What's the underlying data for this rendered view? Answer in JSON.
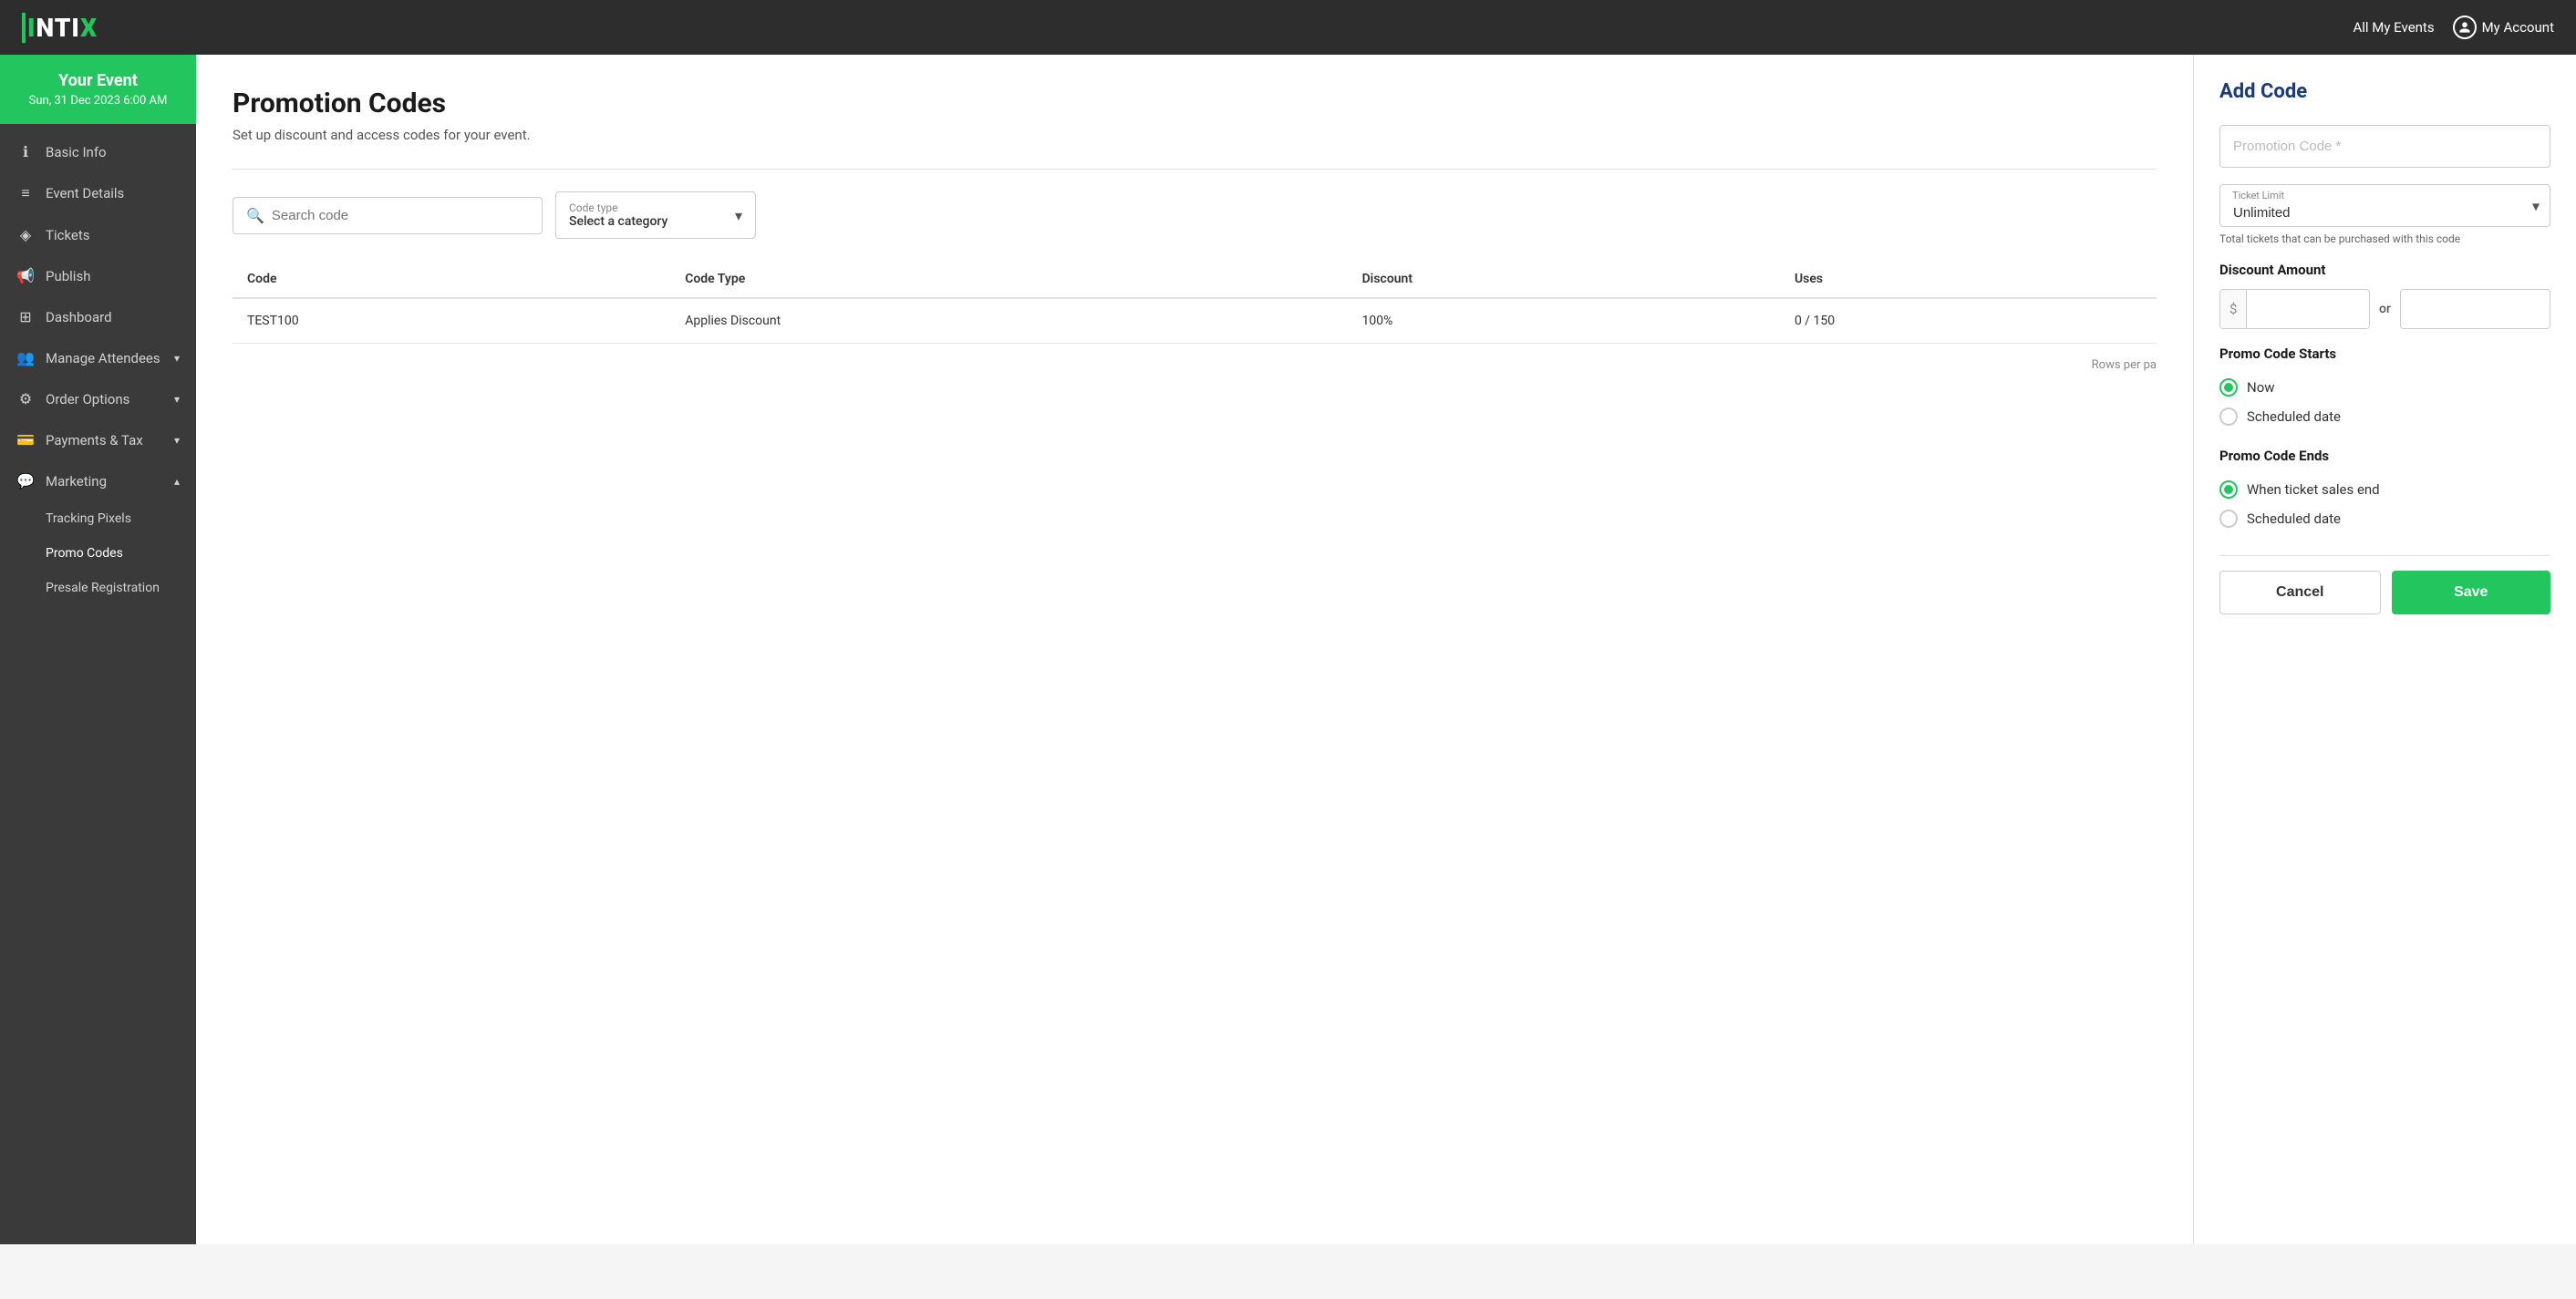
{
  "app": {
    "name": "INTIX",
    "nav_all_events": "All My Events",
    "nav_my_account": "My Account"
  },
  "event": {
    "name": "Your Event",
    "date": "Sun, 31 Dec 2023 6:00 AM"
  },
  "sidebar": {
    "items": [
      {
        "id": "basic-info",
        "label": "Basic Info",
        "icon": "ℹ",
        "has_sub": false
      },
      {
        "id": "event-details",
        "label": "Event Details",
        "icon": "≡",
        "has_sub": false
      },
      {
        "id": "tickets",
        "label": "Tickets",
        "icon": "🎫",
        "has_sub": false
      },
      {
        "id": "publish",
        "label": "Publish",
        "icon": "📢",
        "has_sub": false
      },
      {
        "id": "dashboard",
        "label": "Dashboard",
        "icon": "⊞",
        "has_sub": false
      },
      {
        "id": "manage-attendees",
        "label": "Manage Attendees",
        "icon": "👥",
        "has_chevron": true
      },
      {
        "id": "order-options",
        "label": "Order Options",
        "icon": "⚙",
        "has_chevron": true
      },
      {
        "id": "payments-tax",
        "label": "Payments & Tax",
        "icon": "💳",
        "has_chevron": true
      },
      {
        "id": "marketing",
        "label": "Marketing",
        "icon": "💬",
        "has_chevron": true,
        "expanded": true
      }
    ],
    "sub_items": [
      {
        "id": "tracking-pixels",
        "label": "Tracking Pixels"
      },
      {
        "id": "promo-codes",
        "label": "Promo Codes",
        "active": true
      },
      {
        "id": "presale-registration",
        "label": "Presale Registration"
      }
    ]
  },
  "main": {
    "title": "Promotion Codes",
    "subtitle": "Set up discount and access codes for your event.",
    "search_placeholder": "Search code",
    "filter_label": "Code type",
    "filter_value": "Select a category",
    "table": {
      "headers": [
        "Code",
        "Code Type",
        "Discount",
        "Uses"
      ],
      "rows": [
        {
          "code": "TEST100",
          "code_type": "Applies Discount",
          "discount": "100%",
          "uses": "0 / 150"
        }
      ]
    },
    "rows_per_page_label": "Rows per pa"
  },
  "panel": {
    "title": "Add Code",
    "promo_code_label": "Promotion Code",
    "promo_code_placeholder": "Promotion Code",
    "required_star": "*",
    "ticket_limit_label": "Ticket Limit",
    "ticket_limit_value": "Unlimited",
    "ticket_limit_hint": "Total tickets that can be purchased with this code",
    "discount_amount_label": "Discount Amount",
    "dollar_prefix": "$",
    "or_text": "or",
    "percent_suffix": "%",
    "promo_starts_label": "Promo Code Starts",
    "starts_options": [
      {
        "id": "now",
        "label": "Now",
        "selected": true
      },
      {
        "id": "scheduled",
        "label": "Scheduled date",
        "selected": false
      }
    ],
    "promo_ends_label": "Promo Code Ends",
    "ends_options": [
      {
        "id": "ticket-sales-end",
        "label": "When ticket sales end",
        "selected": true
      },
      {
        "id": "scheduled-end",
        "label": "Scheduled date",
        "selected": false
      }
    ],
    "cancel_label": "Cancel",
    "save_label": "Save"
  }
}
